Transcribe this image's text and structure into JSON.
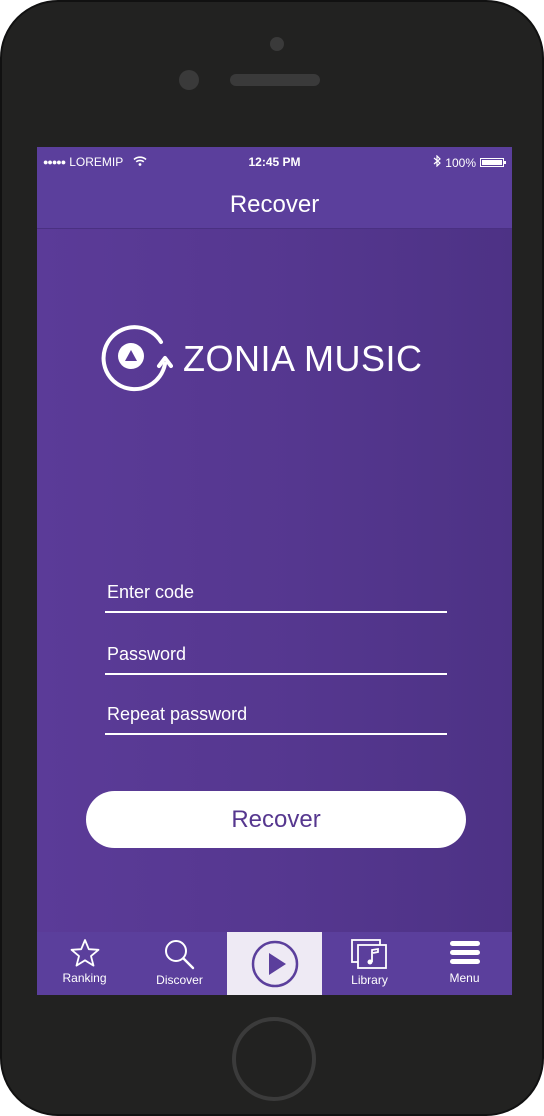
{
  "status_bar": {
    "signal": "●●●●●",
    "carrier": "LOREMIP",
    "time": "12:45 PM",
    "battery": "100%"
  },
  "nav": {
    "title": "Recover"
  },
  "logo": {
    "text": "ZONIA MUSIC"
  },
  "form": {
    "code_placeholder": "Enter code",
    "password_placeholder": "Password",
    "repeat_placeholder": "Repeat password",
    "submit_label": "Recover"
  },
  "tabs": [
    {
      "label": "Ranking",
      "icon": "star-icon"
    },
    {
      "label": "Discover",
      "icon": "search-icon"
    },
    {
      "label": "",
      "icon": "play-icon",
      "active": true
    },
    {
      "label": "Library",
      "icon": "library-icon"
    },
    {
      "label": "Menu",
      "icon": "menu-icon"
    }
  ],
  "colors": {
    "accent": "#5b3f9c",
    "button_text": "#56378f",
    "frame": "#222221"
  }
}
